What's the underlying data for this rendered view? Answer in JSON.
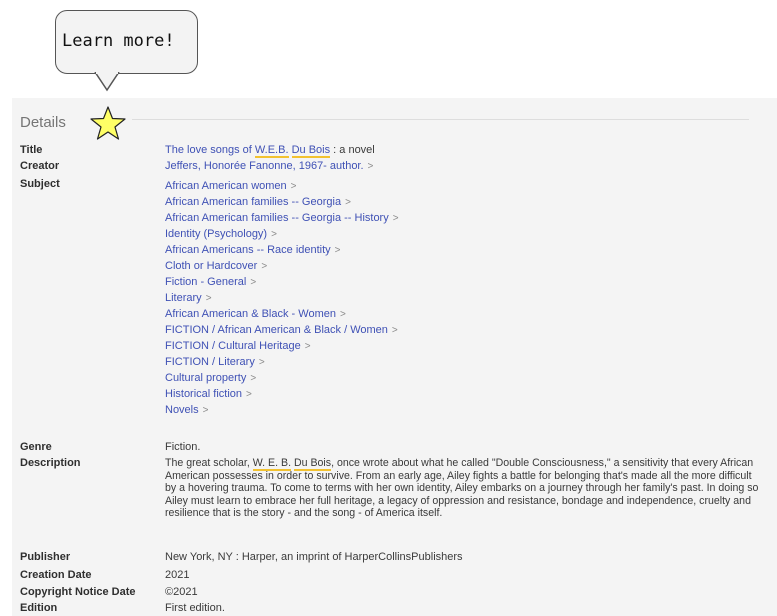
{
  "callout": {
    "text": "Learn more!"
  },
  "details": {
    "heading": "Details",
    "title": {
      "label": "Title",
      "prefix": "The love songs of ",
      "hl_1": "W.E.B.",
      "mid": " ",
      "hl_2": "Du Bois",
      "suffix": " : a novel"
    },
    "creator": {
      "label": "Creator",
      "value": "Jeffers, Honorée Fanonne, 1967- author."
    },
    "subject": {
      "label": "Subject",
      "items": [
        "African American women",
        "African American families -- Georgia",
        "African American families -- Georgia -- History",
        "Identity (Psychology)",
        "African Americans -- Race identity",
        "Cloth or Hardcover",
        "Fiction - General",
        "Literary",
        "African American & Black - Women",
        "FICTION / African American & Black / Women",
        "FICTION / Cultural Heritage",
        "FICTION / Literary",
        "Cultural property",
        "Historical fiction",
        "Novels"
      ]
    },
    "genre": {
      "label": "Genre",
      "value": "Fiction."
    },
    "description": {
      "label": "Description",
      "prefix": "The great scholar, ",
      "hl_1": "W. E. B.",
      "mid": " ",
      "hl_2": "Du Bois",
      "suffix": ", once wrote about what he called \"Double Consciousness,\" a sensitivity that every African American possesses in order to survive. From an early age, Ailey fights a battle for belonging that's made all the more difficult by a hovering trauma. To come to terms with her own identity, Ailey embarks on a journey through her family's past. In doing so Ailey must learn to embrace her full heritage, a legacy of oppression and resistance, bondage and independence, cruelty and resilience that is the story - and the song - of America itself."
    },
    "publisher": {
      "label": "Publisher",
      "value": "New York, NY : Harper, an imprint of HarperCollinsPublishers"
    },
    "creation_date": {
      "label": "Creation Date",
      "value": "2021"
    },
    "copyright": {
      "label": "Copyright Notice Date",
      "value": "©2021"
    },
    "edition": {
      "label": "Edition",
      "value": "First edition."
    }
  },
  "icons": {
    "chevron": "chevron-right-icon",
    "star": "star-icon"
  },
  "colors": {
    "link": "#3f51b5",
    "highlight": "#f2c230",
    "star_fill": "#ffff66",
    "panel_bg": "#f4f4f4"
  }
}
